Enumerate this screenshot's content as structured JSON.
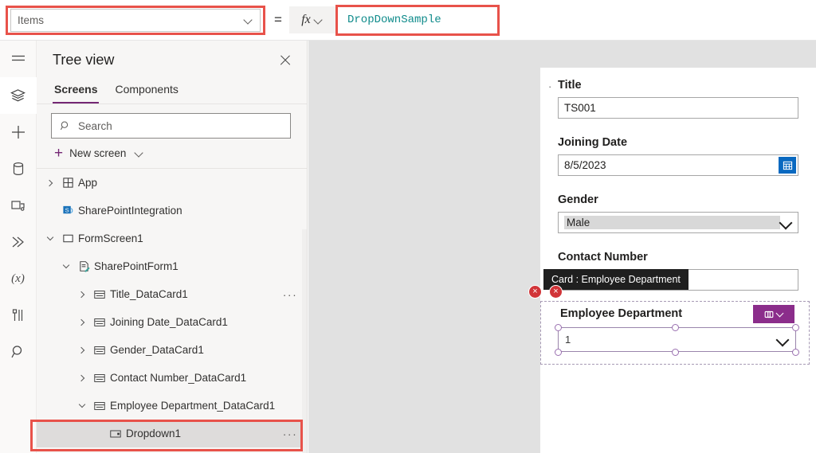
{
  "formula_bar": {
    "property_value": "Items",
    "equals": "=",
    "fx_label": "fx",
    "formula_value": "DropDownSample"
  },
  "rail": {
    "items": [
      {
        "icon": "hamburger-menu-icon",
        "name": "menu"
      },
      {
        "icon": "layers-icon",
        "name": "tree-view"
      },
      {
        "icon": "plus-icon",
        "name": "insert"
      },
      {
        "icon": "database-icon",
        "name": "data"
      },
      {
        "icon": "media-icon",
        "name": "media"
      },
      {
        "icon": "power-automate-icon",
        "name": "power-automate"
      },
      {
        "icon": "variables-icon",
        "name": "variables"
      },
      {
        "icon": "tools-icon",
        "name": "advanced-tools"
      },
      {
        "icon": "search-icon",
        "name": "search"
      }
    ],
    "variables_label": "(x)"
  },
  "tree_panel": {
    "title": "Tree view",
    "tabs": [
      {
        "label": "Screens",
        "active": true
      },
      {
        "label": "Components",
        "active": false
      }
    ],
    "search_placeholder": "Search",
    "new_screen_label": "New screen",
    "items": [
      {
        "label": "App",
        "indent": 0,
        "twisty": "collapsed",
        "icon": "app-grid-icon",
        "selected": false,
        "dots": false
      },
      {
        "label": "SharePointIntegration",
        "indent": 0,
        "twisty": "none",
        "icon": "sharepoint-icon",
        "selected": false,
        "dots": false
      },
      {
        "label": "FormScreen1",
        "indent": 0,
        "twisty": "expanded",
        "icon": "screen-icon",
        "selected": false,
        "dots": false
      },
      {
        "label": "SharePointForm1",
        "indent": 1,
        "twisty": "expanded",
        "icon": "form-icon",
        "selected": false,
        "dots": false
      },
      {
        "label": "Title_DataCard1",
        "indent": 2,
        "twisty": "collapsed",
        "icon": "datacard-icon",
        "selected": false,
        "dots": true
      },
      {
        "label": "Joining Date_DataCard1",
        "indent": 2,
        "twisty": "collapsed",
        "icon": "datacard-icon",
        "selected": false,
        "dots": false
      },
      {
        "label": "Gender_DataCard1",
        "indent": 2,
        "twisty": "collapsed",
        "icon": "datacard-icon",
        "selected": false,
        "dots": false
      },
      {
        "label": "Contact Number_DataCard1",
        "indent": 2,
        "twisty": "collapsed",
        "icon": "datacard-icon",
        "selected": false,
        "dots": false
      },
      {
        "label": "Employee Department_DataCard1",
        "indent": 2,
        "twisty": "expanded",
        "icon": "datacard-icon",
        "selected": false,
        "dots": false
      },
      {
        "label": "Dropdown1",
        "indent": 3,
        "twisty": "none",
        "icon": "dropdown-icon",
        "selected": true,
        "dots": true
      }
    ]
  },
  "canvas": {
    "fields": [
      {
        "label": "Title",
        "value": "TS001",
        "type": "text",
        "required": true
      },
      {
        "label": "Joining Date",
        "value": "8/5/2023",
        "type": "date",
        "required": false
      },
      {
        "label": "Gender",
        "value": "Male",
        "type": "dropdown",
        "highlight": true,
        "required": false
      },
      {
        "label": "Contact Number",
        "value": "",
        "type": "text",
        "required": false
      }
    ],
    "selected_card": {
      "label": "Employee Department",
      "dropdown_value": "1",
      "menu_icon": "layers-icon"
    },
    "tooltip": "Card : Employee Department",
    "error_badges": [
      "×",
      "×"
    ]
  },
  "colors": {
    "accent_purple": "#742774",
    "formula_teal": "#0f8b8b",
    "error_red": "#d13438",
    "annotation_red": "#e8524a",
    "card_menu_purple": "#8b2d8b"
  }
}
